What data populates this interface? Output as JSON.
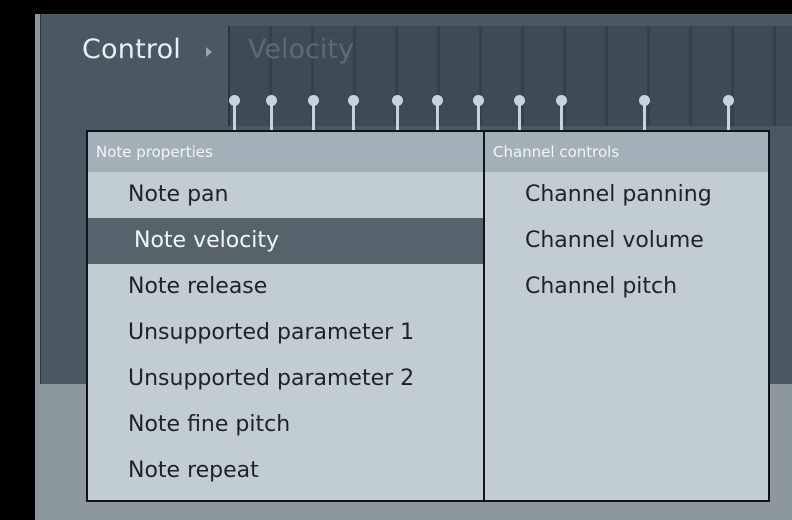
{
  "header": {
    "control_label": "Control",
    "velocity_label": "Velocity"
  },
  "menu": {
    "left_section": {
      "title": "Note properties",
      "items": [
        {
          "label": "Note pan"
        },
        {
          "label": "Note velocity",
          "selected": true
        },
        {
          "label": "Note release"
        },
        {
          "label": "Unsupported parameter 1"
        },
        {
          "label": "Unsupported parameter 2"
        },
        {
          "label": "Note fine pitch"
        },
        {
          "label": "Note repeat"
        }
      ]
    },
    "right_section": {
      "title": "Channel controls",
      "items": [
        {
          "label": "Channel panning"
        },
        {
          "label": "Channel volume"
        },
        {
          "label": "Channel pitch"
        }
      ]
    }
  },
  "colors": {
    "selected_bg": "#56636b",
    "menu_bg": "#c2ccd3",
    "header_bg": "#a4b0b8"
  }
}
